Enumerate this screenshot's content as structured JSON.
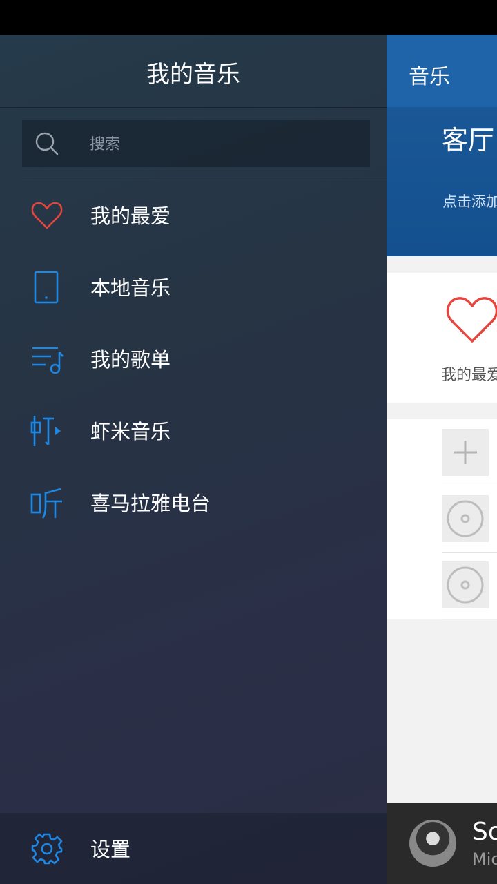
{
  "drawer": {
    "title": "我的音乐",
    "search_placeholder": "搜索",
    "items": [
      {
        "label": "我的最爱",
        "icon": "heart-icon"
      },
      {
        "label": "本地音乐",
        "icon": "tablet-icon"
      },
      {
        "label": "我的歌单",
        "icon": "playlist-icon"
      },
      {
        "label": "虾米音乐",
        "icon": "xiami-icon"
      },
      {
        "label": "喜马拉雅电台",
        "icon": "ting-icon"
      }
    ],
    "settings_label": "设置",
    "colors": {
      "accent": "#1e88e5",
      "heart": "#e5453d"
    }
  },
  "main": {
    "title": "音乐",
    "banner_title": "客厅",
    "banner_subtitle": "点击添加",
    "favorite_label": "我的最爱",
    "player": {
      "title": "So",
      "artist": "Mic"
    }
  }
}
